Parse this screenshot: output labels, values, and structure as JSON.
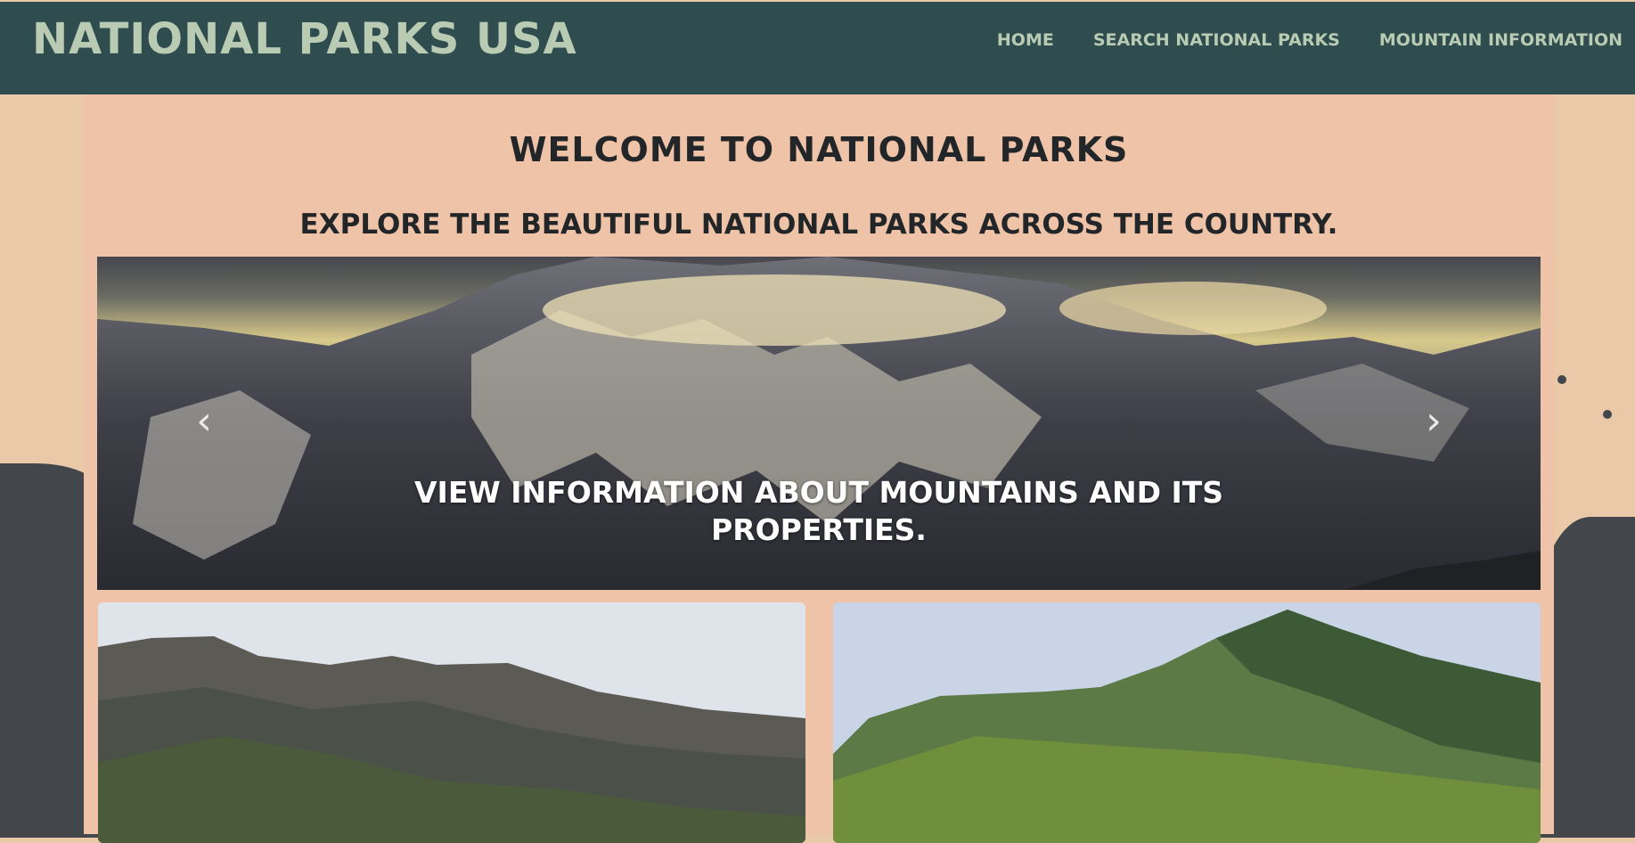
{
  "brand": "NATIONAL PARKS USA",
  "nav": [
    {
      "label": "HOME"
    },
    {
      "label": "SEARCH NATIONAL PARKS"
    },
    {
      "label": "MOUNTAIN INFORMATION"
    }
  ],
  "main": {
    "welcome": "WELCOME TO NATIONAL PARKS",
    "tagline": "EXPLORE THE BEAUTIFUL NATIONAL PARKS ACROSS THE COUNTRY.",
    "carousel": {
      "caption": "VIEW INFORMATION ABOUT MOUNTAINS AND ITS PROPERTIES.",
      "prev_icon": "chevron-left-icon",
      "next_icon": "chevron-right-icon"
    }
  },
  "colors": {
    "navbar": "#2f4c4f",
    "nav_text": "#b9ccb3",
    "panel": "#efc3a7",
    "page_bg": "#e9c9a8",
    "heading": "#232629"
  }
}
